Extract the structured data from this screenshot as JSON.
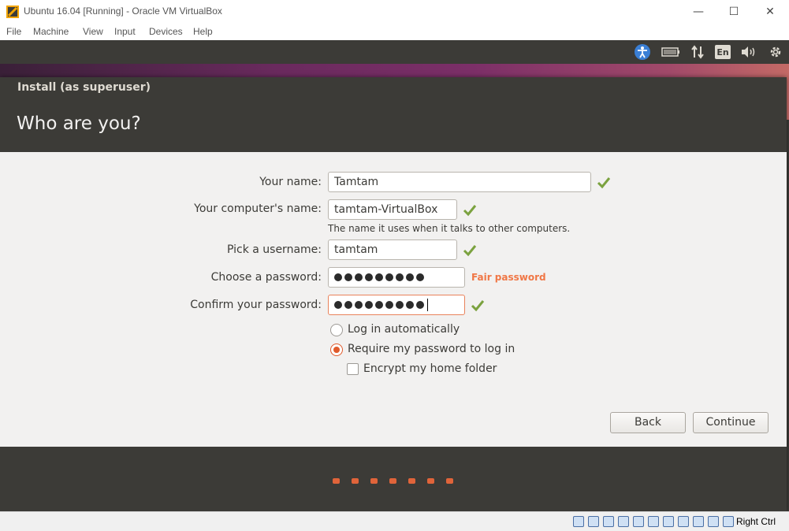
{
  "window": {
    "title": "Ubuntu 16.04 [Running] - Oracle VM VirtualBox",
    "minimize_glyph": "—",
    "maximize_glyph": "☐",
    "close_glyph": "✕"
  },
  "menubar": [
    "File",
    "Machine",
    "View",
    "Input",
    "Devices",
    "Help"
  ],
  "tray": {
    "accessibility_icon": "accessibility-icon",
    "battery_icon": "battery-icon",
    "network_icon": "network-icon",
    "keyboard_layout": "En",
    "volume_icon": "volume-icon",
    "settings_icon": "gear-icon"
  },
  "installer": {
    "window_title": "Install (as superuser)",
    "page_title": "Who are you?",
    "fields": {
      "your_name": {
        "label": "Your name:",
        "value": "Tamtam"
      },
      "computer_name": {
        "label": "Your computer's name:",
        "value": "tamtam-VirtualBox",
        "hint": "The name it uses when it talks to other computers."
      },
      "username": {
        "label": "Pick a username:",
        "value": "tamtam"
      },
      "password": {
        "label": "Choose a password:",
        "masked_length": 9,
        "strength": "Fair password"
      },
      "confirm_password": {
        "label": "Confirm your password:",
        "masked_length": 9
      }
    },
    "options": {
      "login_auto": {
        "label": "Log in automatically",
        "selected": false
      },
      "require_password": {
        "label": "Require my password to log in",
        "selected": true
      },
      "encrypt_home": {
        "label": "Encrypt my home folder",
        "checked": false
      }
    },
    "buttons": {
      "back": "Back",
      "continue": "Continue"
    },
    "progress": {
      "total_steps": 7
    }
  },
  "statusbar": {
    "host_key": "Right Ctrl"
  },
  "colors": {
    "ubuntu_dark": "#3c3b37",
    "accent_orange": "#e05a2b",
    "check_green": "#7ba23f"
  }
}
